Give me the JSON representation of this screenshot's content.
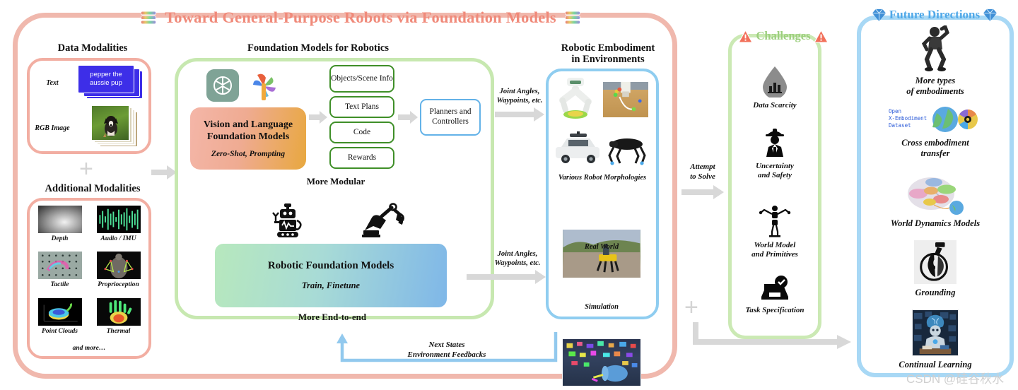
{
  "title": {
    "text": "Toward General-Purpose Robots via Foundation Models",
    "color": "#f08a7a",
    "left_icon": "books-icon",
    "right_icon": "books-icon"
  },
  "data_modalities": {
    "caption": "Data Modalities",
    "items": [
      {
        "label": "Text",
        "sample": "pepper the aussie pup",
        "icon": "text-card-stack-icon"
      },
      {
        "label": "RGB Image",
        "icon": "photo-stack-icon"
      }
    ],
    "plus": "+"
  },
  "additional_modalities": {
    "caption": "Additional Modalities",
    "items": [
      {
        "label": "Depth",
        "icon": "depth-map-thumbnail"
      },
      {
        "label": "Audio / IMU",
        "icon": "audio-waveform-thumbnail"
      },
      {
        "label": "Tactile",
        "icon": "tactile-sensor-thumbnail"
      },
      {
        "label": "Proprioception",
        "icon": "proprioception-skeleton-thumbnail"
      },
      {
        "label": "Point Clouds",
        "icon": "point-cloud-thumbnail"
      },
      {
        "label": "Thermal",
        "icon": "thermal-hand-thumbnail"
      }
    ],
    "footer": "and more…"
  },
  "foundation_models": {
    "caption": "Foundation Models for Robotics",
    "logos": [
      {
        "name": "openai-logo",
        "color": "#7fa396"
      },
      {
        "name": "gemini-pinwheel-logo",
        "color": "#4a86e8"
      }
    ],
    "vlm_box": {
      "title_line1": "Vision and Language",
      "title_line2": "Foundation Models",
      "subtitle": "Zero-Shot, Prompting",
      "gradient_from": "#f4b6a8",
      "gradient_to": "#e8a83f"
    },
    "outputs": [
      {
        "label": "Objects/Scene Info",
        "border": "#3f8f28"
      },
      {
        "label": "Text Plans",
        "border": "#3f8f28"
      },
      {
        "label": "Code",
        "border": "#3f8f28"
      },
      {
        "label": "Rewards",
        "border": "#3f8f28"
      }
    ],
    "planners": {
      "label": "Planners and Controllers",
      "border": "#63b2e8"
    },
    "modular_label": "More Modular",
    "rfm_box": {
      "title": "Robotic Foundation Models",
      "subtitle": "Train, Finetune",
      "gradient_from": "#b7e8bd",
      "gradient_to": "#7fb7e8"
    },
    "end_to_end_label": "More End-to-end",
    "icons": [
      {
        "name": "robot-icon"
      },
      {
        "name": "robotic-arm-icon"
      }
    ]
  },
  "flow_labels": {
    "joint_angles_top": "Joint Angles,\nWaypoints, etc.",
    "joint_angles_top_l1": "Joint Angles,",
    "joint_angles_top_l2": "Waypoints, etc.",
    "joint_angles_bottom_l1": "Joint Angles,",
    "joint_angles_bottom_l2": "Waypoints, etc.",
    "feedback_l1": "Next States",
    "feedback_l2": "Environment Feedbacks",
    "attempt_l1": "Attempt",
    "attempt_l2": "to Solve"
  },
  "embodiment": {
    "caption_l1": "Robotic Embodiment",
    "caption_l2": "in Environments",
    "morphologies_label": "Various Robot Morphologies",
    "real_world_label": "Real World",
    "simulation_label": "Simulation",
    "thumbnails": [
      "white-robot-arm-photo",
      "tabletop-manipulation-photo",
      "autonomous-car-photo",
      "quadruped-robot-photo",
      "spot-robot-outdoors-photo",
      "simulation-scene-photo"
    ]
  },
  "challenges": {
    "header": "Challenges",
    "header_color": "#9ccf7e",
    "warn_icon": "warning-triangle-icon",
    "items": [
      {
        "label_l1": "Data Scarcity",
        "label_l2": "",
        "icon": "data-droplet-icon"
      },
      {
        "label_l1": "Uncertainty",
        "label_l2": "and Safety",
        "icon": "worker-person-icon"
      },
      {
        "label_l1": "World Model",
        "label_l2": "and Primitives",
        "icon": "humanoid-figure-icon"
      },
      {
        "label_l1": "Task Specification",
        "label_l2": "",
        "icon": "checked-tray-icon"
      }
    ],
    "plus": "+"
  },
  "future_directions": {
    "header": "Future Directions",
    "header_color": "#4fa8e8",
    "gem_icon": "diamond-icon",
    "items": [
      {
        "label_l1": "More types",
        "label_l2": "of embodiments",
        "icon": "humanoid-robot-photo"
      },
      {
        "label_l1": "Cross embodiment",
        "label_l2": "transfer",
        "icon": "open-x-embodiment-dataset-logo",
        "logo_text_l1": "Open",
        "logo_text_l2": "X-Embodiment",
        "logo_text_l3": "Dataset"
      },
      {
        "label_l1": "World Dynamics Models",
        "label_l2": "",
        "icon": "brain-diagram-photo"
      },
      {
        "label_l1": "Grounding",
        "label_l2": "",
        "icon": "hand-globe-icon"
      },
      {
        "label_l1": "Continual Learning",
        "label_l2": "",
        "icon": "robot-studying-photo"
      }
    ]
  },
  "watermark": {
    "text": "CSDN @硅谷秋水",
    "color": "#cfcfcf"
  }
}
